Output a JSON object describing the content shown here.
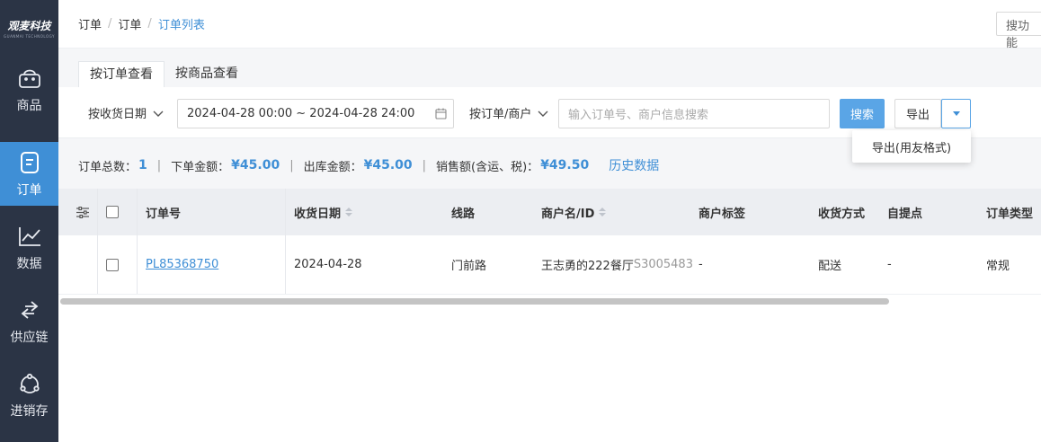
{
  "app": {
    "brand": "观麦科技",
    "brand_sub": "GUANMAI TECHNOLOGY"
  },
  "sidebar": {
    "items": [
      {
        "label": "商品",
        "icon": "basket-icon"
      },
      {
        "label": "订单",
        "icon": "order-icon",
        "active": true
      },
      {
        "label": "数据",
        "icon": "chart-icon"
      },
      {
        "label": "供应链",
        "icon": "exchange-icon"
      },
      {
        "label": "进销存",
        "icon": "cycle-icon"
      }
    ]
  },
  "breadcrumb": [
    "订单",
    "订单",
    "订单列表"
  ],
  "header": {
    "function_search": "搜功能"
  },
  "tabs": [
    "按订单查看",
    "按商品查看"
  ],
  "filters": {
    "date_type": "按收货日期",
    "date_range": "2024-04-28 00:00 ~ 2024-04-28 24:00",
    "search_type": "按订单/商户",
    "search_placeholder": "输入订单号、商户信息搜索",
    "search_button": "搜索",
    "export_button": "导出",
    "export_menu_item": "导出(用友格式)"
  },
  "summary": {
    "total_orders_label": "订单总数：",
    "total_orders": "1",
    "order_amount_label": "下单金额：",
    "order_amount": "¥45.00",
    "outbound_amount_label": "出库金额：",
    "outbound_amount": "¥45.00",
    "sales_label": "销售额(含运、税)：",
    "sales": "¥49.50",
    "history_link": "历史数据"
  },
  "table": {
    "columns": [
      "订单号",
      "收货日期",
      "线路",
      "商户名/ID",
      "商户标签",
      "收货方式",
      "自提点",
      "订单类型"
    ],
    "rows": [
      {
        "order_no": "PL85368750",
        "date": "2024-04-28",
        "route": "门前路",
        "merchant_name": "王志勇的222餐厅",
        "merchant_id": "S3005483",
        "tag": "-",
        "delivery": "配送",
        "pickup": "-",
        "type": "常规"
      }
    ]
  },
  "colors": {
    "sidebar_bg": "#2b3445",
    "accent": "#3f8fd6",
    "primary_button": "#5aa5e6"
  }
}
